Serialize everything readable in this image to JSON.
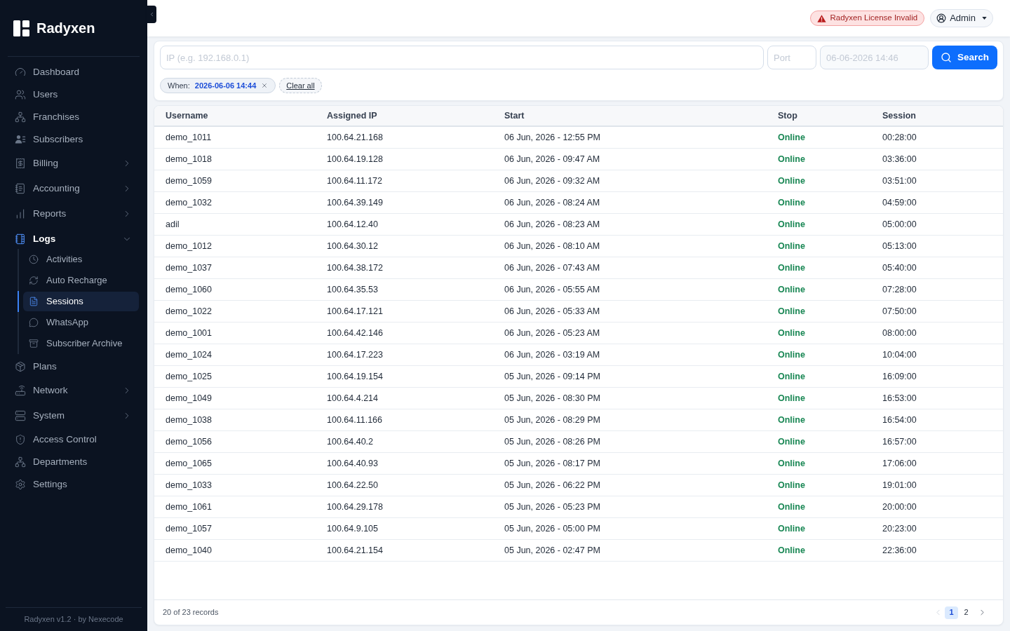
{
  "brand": {
    "name": "Radyxen"
  },
  "sidebar": {
    "items": [
      {
        "label": "Dashboard",
        "selected": false
      },
      {
        "label": "Users",
        "selected": false
      },
      {
        "label": "Franchises",
        "selected": false
      },
      {
        "label": "Subscribers",
        "selected": false
      },
      {
        "label": "Billing",
        "selected": false,
        "expanded": false
      },
      {
        "label": "Accounting",
        "selected": false,
        "expanded": false
      },
      {
        "label": "Reports",
        "selected": false,
        "expanded": false
      },
      {
        "label": "Logs",
        "selected": true,
        "expanded": true,
        "children": [
          {
            "label": "Activities",
            "selected": false
          },
          {
            "label": "Auto Recharge",
            "selected": false
          },
          {
            "label": "Sessions",
            "selected": true
          },
          {
            "label": "WhatsApp",
            "selected": false
          },
          {
            "label": "Subscriber Archive",
            "selected": false
          }
        ]
      },
      {
        "label": "Plans",
        "selected": false
      },
      {
        "label": "Network",
        "selected": false,
        "expanded": false
      },
      {
        "label": "System",
        "selected": false,
        "expanded": false
      },
      {
        "label": "Access Control",
        "selected": false
      },
      {
        "label": "Departments",
        "selected": false
      },
      {
        "label": "Settings",
        "selected": false
      }
    ],
    "footer": "Radyxen v1.2 · by Nexecode"
  },
  "topbar": {
    "license_alert": "Radyxen License Invalid",
    "user_menu": "Admin"
  },
  "filters": {
    "ip": {
      "placeholder": "IP (e.g. 192.168.0.1)"
    },
    "port": {
      "placeholder": "Port"
    },
    "when": {
      "placeholder": "06-06-2026 14:46"
    },
    "search_button": "Search",
    "active_filters": [
      {
        "label": "When:",
        "value": "2026-06-06 14:44"
      }
    ],
    "clear_all": "Clear all"
  },
  "table": {
    "columns": [
      "Username",
      "Assigned IP",
      "Start",
      "Stop",
      "Session"
    ],
    "rows": [
      {
        "username": "demo_1011",
        "assigned_ip": "100.64.21.168",
        "start": "06 Jun, 2026 - 12:55 PM",
        "stop": "Online",
        "session": "00:28:00"
      },
      {
        "username": "demo_1018",
        "assigned_ip": "100.64.19.128",
        "start": "06 Jun, 2026 - 09:47 AM",
        "stop": "Online",
        "session": "03:36:00"
      },
      {
        "username": "demo_1059",
        "assigned_ip": "100.64.11.172",
        "start": "06 Jun, 2026 - 09:32 AM",
        "stop": "Online",
        "session": "03:51:00"
      },
      {
        "username": "demo_1032",
        "assigned_ip": "100.64.39.149",
        "start": "06 Jun, 2026 - 08:24 AM",
        "stop": "Online",
        "session": "04:59:00"
      },
      {
        "username": "adil",
        "assigned_ip": "100.64.12.40",
        "start": "06 Jun, 2026 - 08:23 AM",
        "stop": "Online",
        "session": "05:00:00"
      },
      {
        "username": "demo_1012",
        "assigned_ip": "100.64.30.12",
        "start": "06 Jun, 2026 - 08:10 AM",
        "stop": "Online",
        "session": "05:13:00"
      },
      {
        "username": "demo_1037",
        "assigned_ip": "100.64.38.172",
        "start": "06 Jun, 2026 - 07:43 AM",
        "stop": "Online",
        "session": "05:40:00"
      },
      {
        "username": "demo_1060",
        "assigned_ip": "100.64.35.53",
        "start": "06 Jun, 2026 - 05:55 AM",
        "stop": "Online",
        "session": "07:28:00"
      },
      {
        "username": "demo_1022",
        "assigned_ip": "100.64.17.121",
        "start": "06 Jun, 2026 - 05:33 AM",
        "stop": "Online",
        "session": "07:50:00"
      },
      {
        "username": "demo_1001",
        "assigned_ip": "100.64.42.146",
        "start": "06 Jun, 2026 - 05:23 AM",
        "stop": "Online",
        "session": "08:00:00"
      },
      {
        "username": "demo_1024",
        "assigned_ip": "100.64.17.223",
        "start": "06 Jun, 2026 - 03:19 AM",
        "stop": "Online",
        "session": "10:04:00"
      },
      {
        "username": "demo_1025",
        "assigned_ip": "100.64.19.154",
        "start": "05 Jun, 2026 - 09:14 PM",
        "stop": "Online",
        "session": "16:09:00"
      },
      {
        "username": "demo_1049",
        "assigned_ip": "100.64.4.214",
        "start": "05 Jun, 2026 - 08:30 PM",
        "stop": "Online",
        "session": "16:53:00"
      },
      {
        "username": "demo_1038",
        "assigned_ip": "100.64.11.166",
        "start": "05 Jun, 2026 - 08:29 PM",
        "stop": "Online",
        "session": "16:54:00"
      },
      {
        "username": "demo_1056",
        "assigned_ip": "100.64.40.2",
        "start": "05 Jun, 2026 - 08:26 PM",
        "stop": "Online",
        "session": "16:57:00"
      },
      {
        "username": "demo_1065",
        "assigned_ip": "100.64.40.93",
        "start": "05 Jun, 2026 - 08:17 PM",
        "stop": "Online",
        "session": "17:06:00"
      },
      {
        "username": "demo_1033",
        "assigned_ip": "100.64.22.50",
        "start": "05 Jun, 2026 - 06:22 PM",
        "stop": "Online",
        "session": "19:01:00"
      },
      {
        "username": "demo_1061",
        "assigned_ip": "100.64.29.178",
        "start": "05 Jun, 2026 - 05:23 PM",
        "stop": "Online",
        "session": "20:00:00"
      },
      {
        "username": "demo_1057",
        "assigned_ip": "100.64.9.105",
        "start": "05 Jun, 2026 - 05:00 PM",
        "stop": "Online",
        "session": "20:23:00"
      },
      {
        "username": "demo_1040",
        "assigned_ip": "100.64.21.154",
        "start": "05 Jun, 2026 - 02:47 PM",
        "stop": "Online",
        "session": "22:36:00"
      }
    ]
  },
  "footer": {
    "summary": "20 of 23 records",
    "previous": {
      "disabled": true
    },
    "pages": [
      {
        "label": "1",
        "selected": true
      },
      {
        "label": "2",
        "selected": false
      }
    ],
    "next": {
      "disabled": false
    }
  }
}
